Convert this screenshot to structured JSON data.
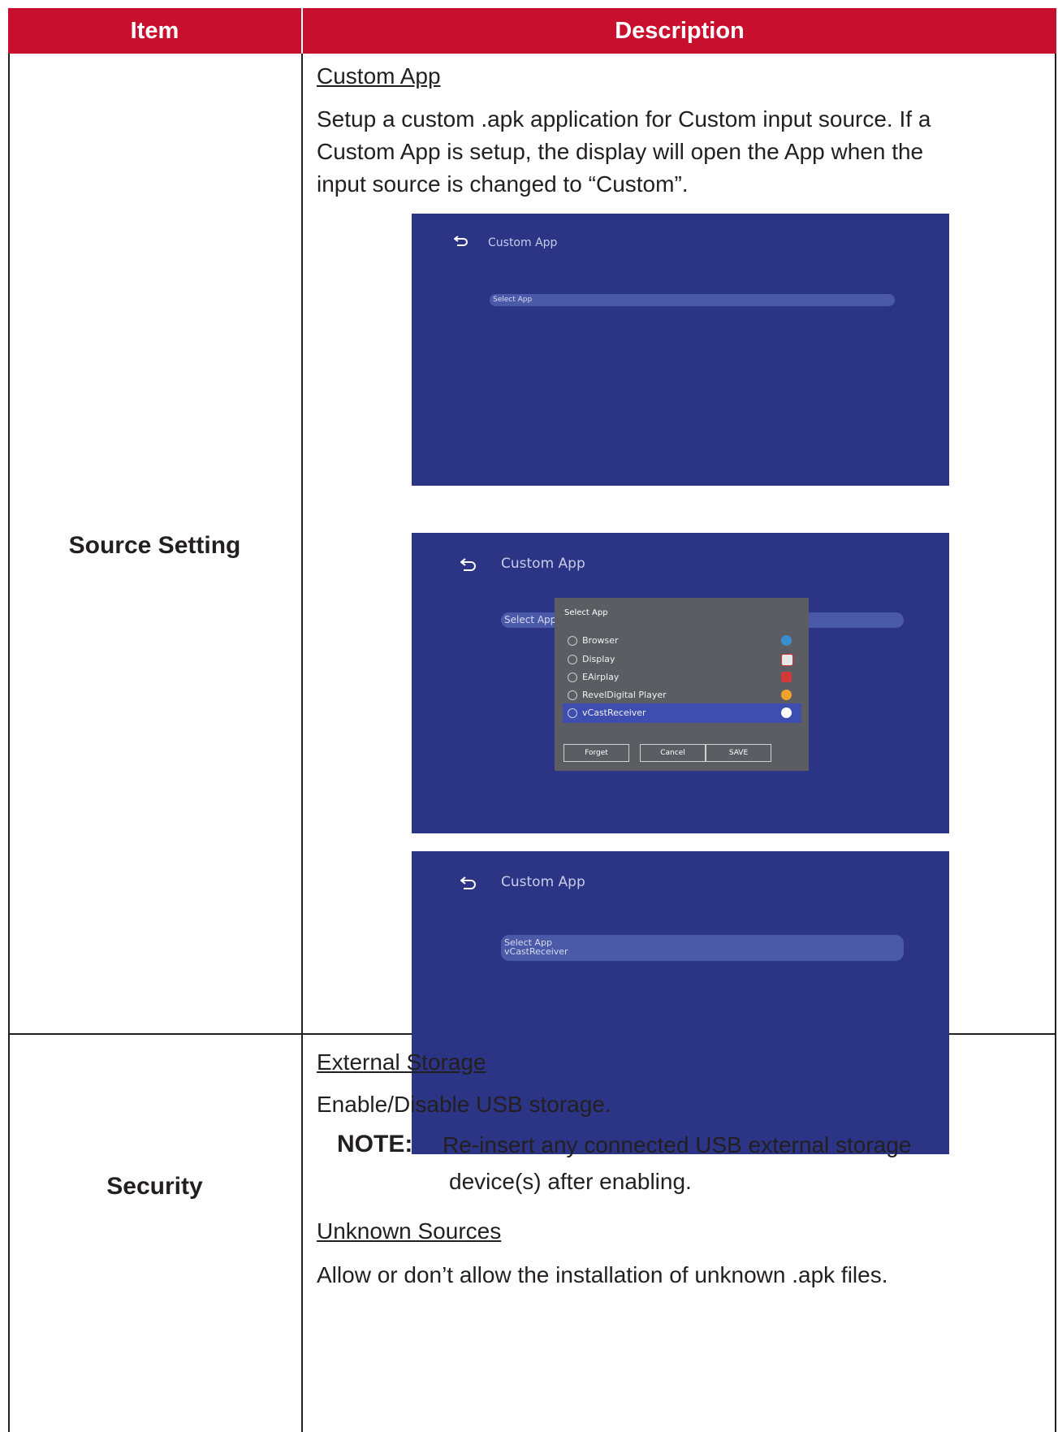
{
  "header": {
    "item": "Item",
    "description": "Description"
  },
  "rows": [
    {
      "item": "Source Setting",
      "subheading": "Custom App",
      "body_lines": [
        "Setup a custom .apk application for Custom input source. If a",
        "Custom App is setup, the display will open the App when the",
        "input source is changed to “Custom”."
      ],
      "screens": [
        {
          "title": "Custom App",
          "field_label": "Select App"
        },
        {
          "title": "Custom App",
          "field_label": "Select App",
          "dialog": {
            "title": "Select App",
            "options": [
              "Browser",
              "Display",
              "EAirplay",
              "RevelDigital Player",
              "vCastReceiver"
            ],
            "selected": "vCastReceiver",
            "buttons": [
              "Forget",
              "Cancel",
              "SAVE"
            ]
          }
        },
        {
          "title": "Custom App",
          "field_label": "Select App",
          "field_value": "vCastReceiver"
        }
      ]
    },
    {
      "item": "Security",
      "sections": [
        {
          "subheading": "External Storage",
          "body": "Enable/Disable USB storage.",
          "note_label": "NOTE:",
          "note_lines": [
            "Re-insert any connected USB external storage",
            "device(s) after enabling."
          ]
        },
        {
          "subheading": "Unknown Sources",
          "body": "Allow or don’t allow the installation of unknown .apk files."
        }
      ]
    }
  ],
  "icons": [
    "back-arrow-icon",
    "radio-icon",
    "browser-icon",
    "display-icon",
    "eairplay-icon",
    "reveldigital-icon",
    "vcast-icon"
  ],
  "colors": {
    "header_bg": "#c8102e",
    "screen_bg": "#2c3585",
    "dialog_bg": "#5b5d63",
    "selected_row": "#3d4eb0"
  }
}
